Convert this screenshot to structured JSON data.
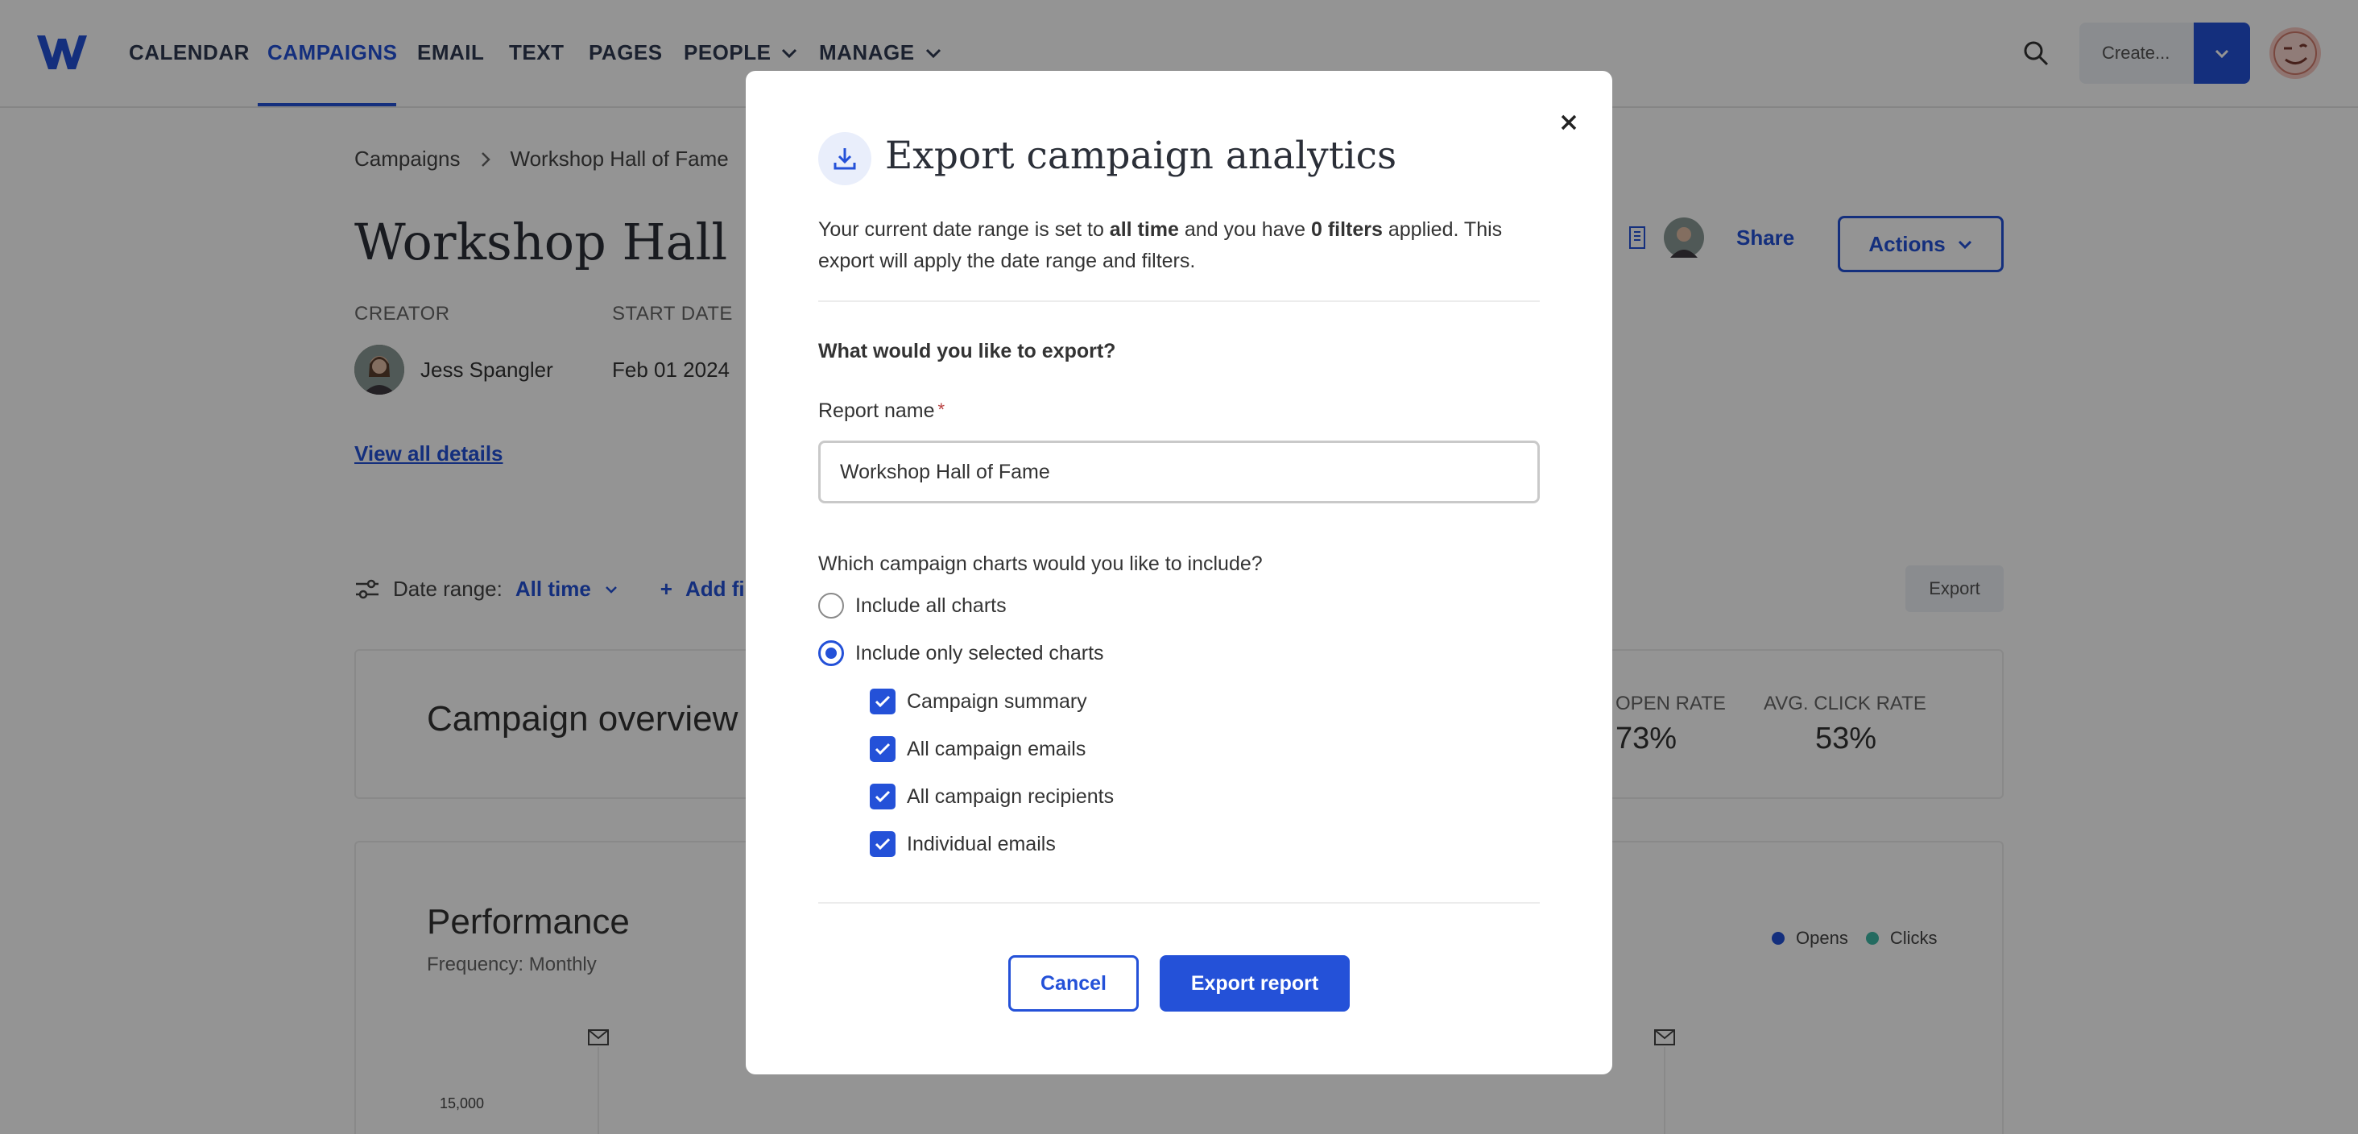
{
  "nav": {
    "items": [
      {
        "label": "CALENDAR"
      },
      {
        "label": "CAMPAIGNS"
      },
      {
        "label": "EMAIL"
      },
      {
        "label": "TEXT"
      },
      {
        "label": "PAGES"
      },
      {
        "label": "PEOPLE"
      },
      {
        "label": "MANAGE"
      }
    ],
    "active": "CAMPAIGNS",
    "create_label": "Create..."
  },
  "page": {
    "breadcrumb": [
      "Campaigns",
      "Workshop Hall of Fame"
    ],
    "title": "Workshop Hall of",
    "meta": {
      "creator_label": "CREATOR",
      "creator_name": "Jess Spangler",
      "start_label": "START DATE",
      "start_value": "Feb 01 2024"
    },
    "view_details": "View all details",
    "share_label": "Share",
    "actions_label": "Actions",
    "date_range_label": "Date range:",
    "date_range_value": "All time",
    "add_filter_label": "Add filt",
    "export_label": "Export",
    "overview": {
      "title": "Campaign overview",
      "stats": [
        {
          "label": "OPEN RATE",
          "value": "73%"
        },
        {
          "label": "AVG. CLICK RATE",
          "value": "53%"
        }
      ]
    },
    "performance": {
      "title": "Performance",
      "frequency": "Frequency: Monthly",
      "legend": [
        {
          "name": "Opens",
          "color": "#2451d8"
        },
        {
          "name": "Clicks",
          "color": "#3fb8a6"
        }
      ],
      "y_tick": "15,000"
    }
  },
  "modal": {
    "title": "Export campaign analytics",
    "desc": {
      "p1": "Your current date range is set to ",
      "b1": "all time",
      "p2": " and you have ",
      "b2": "0 filters",
      "p3": " applied. This export will apply the date range and filters."
    },
    "question": "What would you like to export?",
    "report_name_label": "Report name",
    "report_name_required": "*",
    "report_name_value": "Workshop Hall of Fame",
    "charts_question": "Which campaign charts would you like to include?",
    "radio_options": [
      {
        "label": "Include all charts",
        "checked": false
      },
      {
        "label": "Include only selected charts",
        "checked": true
      }
    ],
    "checkbox_options": [
      {
        "label": "Campaign summary",
        "checked": true
      },
      {
        "label": "All campaign emails",
        "checked": true
      },
      {
        "label": "All campaign recipients",
        "checked": true
      },
      {
        "label": "Individual emails",
        "checked": true
      }
    ],
    "cancel_label": "Cancel",
    "export_label": "Export report"
  },
  "colors": {
    "accent": "#2451d8",
    "overlay": "rgba(0,0,0,0.42)"
  }
}
